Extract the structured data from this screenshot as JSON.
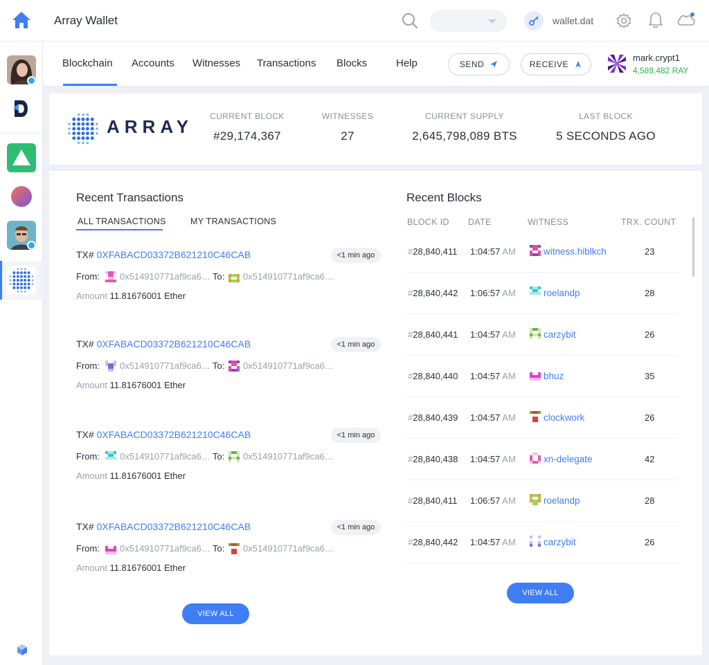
{
  "header": {
    "app_title": "Array Wallet",
    "search": {
      "value": "",
      "placeholder": ""
    },
    "wallet_file": "wallet.dat"
  },
  "nav": {
    "tabs": [
      {
        "label": "Blockchain",
        "active": true
      },
      {
        "label": "Accounts"
      },
      {
        "label": "Witnesses"
      },
      {
        "label": "Transactions"
      },
      {
        "label": "Blocks"
      },
      {
        "label": "Help"
      }
    ],
    "send_label": "SEND",
    "receive_label": "RECEIVE",
    "account": {
      "name": "mark.crypt1",
      "balance": "4,589,482 RAY"
    }
  },
  "brand": {
    "name": "ARRAY"
  },
  "stats": [
    {
      "label": "CURRENT BLOCK",
      "value": "#29,174,367"
    },
    {
      "label": "WITNESSES",
      "value": "27"
    },
    {
      "label": "CURRENT SUPPLY",
      "value": "2,645,798,089 BTS"
    },
    {
      "label": "LAST BLOCK",
      "value": "5 SECONDS AGO"
    }
  ],
  "recent_transactions": {
    "title": "Recent Transactions",
    "tabs": [
      "ALL TRANSACTIONS",
      "MY TRANSACTIONS"
    ],
    "labels": {
      "tx_prefix": "TX#",
      "from": "From:",
      "to": "To:",
      "amount": "Amount"
    },
    "items": [
      {
        "hash": "0XFABACD03372B621210C46CAB",
        "time": "<1 min ago",
        "from": "0x514910771af9ca6…",
        "to": "0x514910771af9ca6…",
        "amount": "11.81676001 Ether"
      },
      {
        "hash": "0XFABACD03372B621210C46CAB",
        "time": "<1 min ago",
        "from": "0x514910771af9ca6…",
        "to": "0x514910771af9ca6…",
        "amount": "11.81676001 Ether"
      },
      {
        "hash": "0XFABACD03372B621210C46CAB",
        "time": "<1 min ago",
        "from": "0x514910771af9ca6…",
        "to": "0x514910771af9ca6…",
        "amount": "11.81676001 Ether"
      },
      {
        "hash": "0XFABACD03372B621210C46CAB",
        "time": "<1 min ago",
        "from": "0x514910771af9ca6…",
        "to": "0x514910771af9ca6…",
        "amount": "11.81676001 Ether"
      }
    ],
    "view_all": "VIEW ALL"
  },
  "recent_blocks": {
    "title": "Recent Blocks",
    "columns": [
      "BLOCK ID",
      "DATE",
      "WITNESS",
      "TRX. COUNT"
    ],
    "rows": [
      {
        "id": "28,840,411",
        "time": "1:04:57",
        "ampm": "AM",
        "witness": "witness.hiblkch",
        "count": "23"
      },
      {
        "id": "28,840,442",
        "time": "1:06:57",
        "ampm": "AM",
        "witness": "roelandp",
        "count": "28"
      },
      {
        "id": "28,840,441",
        "time": "1:04:57",
        "ampm": "AM",
        "witness": "carzybit",
        "count": "26"
      },
      {
        "id": "28,840,440",
        "time": "1:04:57",
        "ampm": "AM",
        "witness": "bhuz",
        "count": "35"
      },
      {
        "id": "28,840,439",
        "time": "1:04:57",
        "ampm": "AM",
        "witness": "clockwork",
        "count": "26"
      },
      {
        "id": "28,840,438",
        "time": "1:04:57",
        "ampm": "AM",
        "witness": "xn-delegate",
        "count": "42"
      },
      {
        "id": "28,840,411",
        "time": "1:06:57",
        "ampm": "AM",
        "witness": "roelandp",
        "count": "28"
      },
      {
        "id": "28,840,442",
        "time": "1:04:57",
        "ampm": "AM",
        "witness": "carzybit",
        "count": "26"
      }
    ],
    "view_all": "VIEW ALL"
  },
  "colors": {
    "accent": "#3f7df4",
    "positive": "#2fb344",
    "brand_dark": "#1e2b55"
  }
}
